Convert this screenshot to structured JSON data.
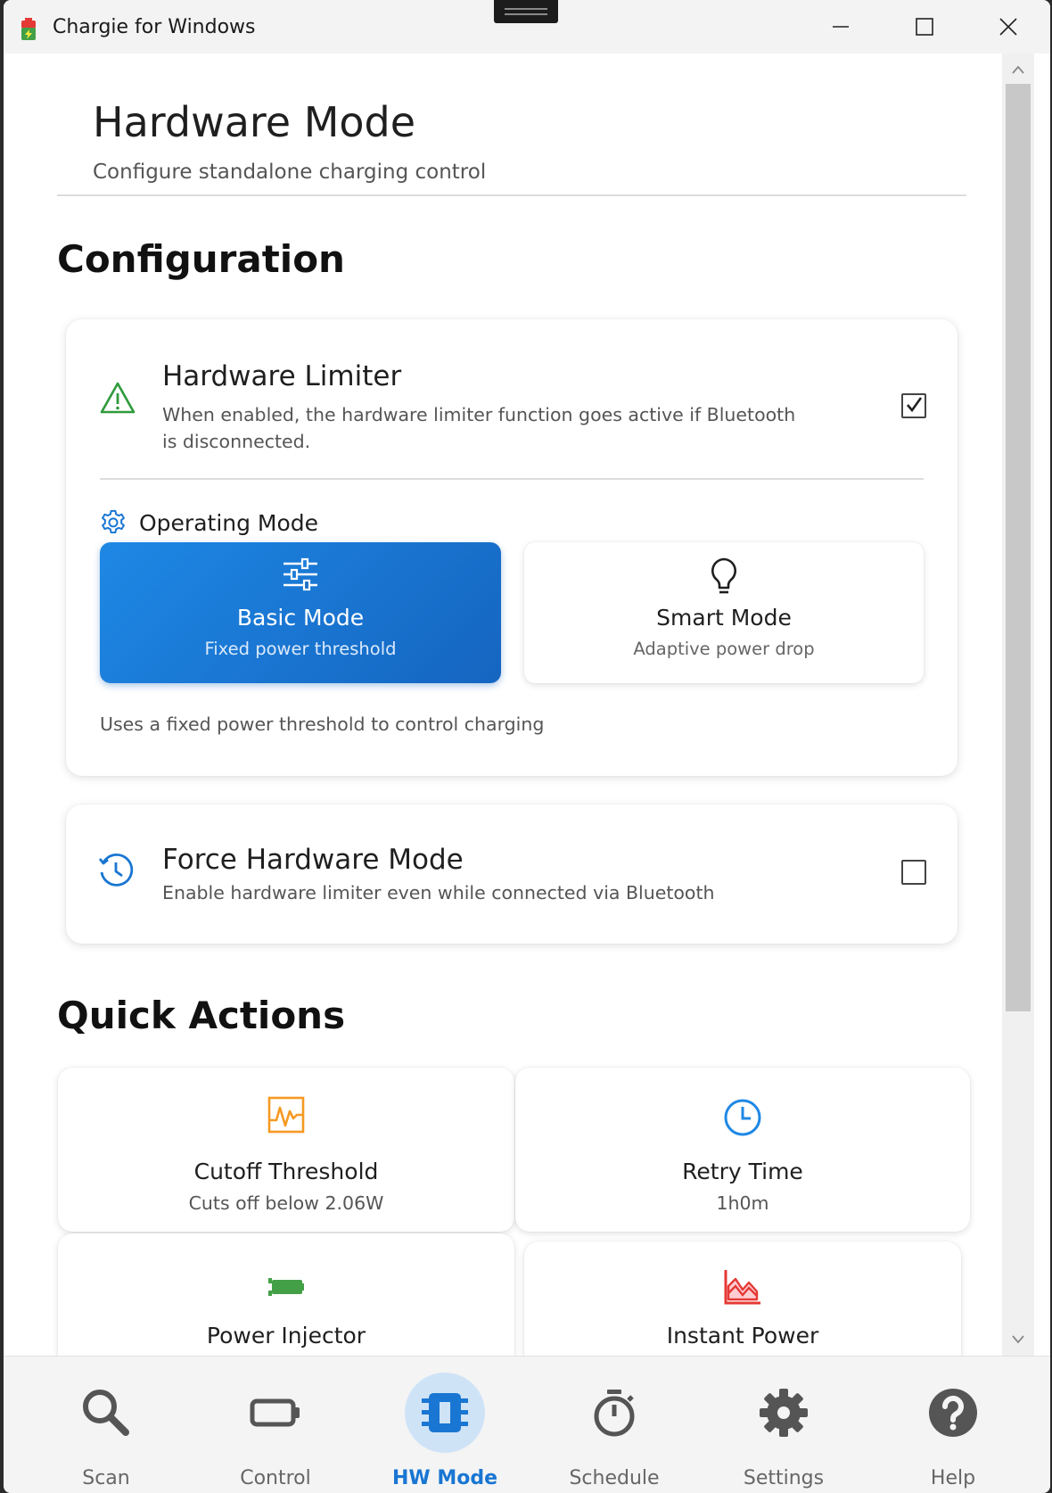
{
  "window": {
    "title": "Chargie for Windows"
  },
  "header": {
    "title": "Hardware Mode",
    "subtitle": "Configure standalone charging control"
  },
  "configuration": {
    "heading": "Configuration",
    "hardware_limiter": {
      "title": "Hardware Limiter",
      "description": "When enabled, the hardware limiter function goes active if Bluetooth is disconnected.",
      "checked": true
    },
    "operating_mode": {
      "label": "Operating Mode",
      "modes": [
        {
          "title": "Basic Mode",
          "subtitle": "Fixed power threshold",
          "selected": true
        },
        {
          "title": "Smart Mode",
          "subtitle": "Adaptive power drop",
          "selected": false
        }
      ],
      "description": "Uses a fixed power threshold to control charging"
    },
    "force_hardware_mode": {
      "title": "Force Hardware Mode",
      "description": "Enable hardware limiter even while connected via Bluetooth",
      "checked": false
    }
  },
  "quick_actions": {
    "heading": "Quick Actions",
    "items": [
      {
        "title": "Cutoff Threshold",
        "subtitle": "Cuts off below 2.06W",
        "icon": "pulse-chart-icon"
      },
      {
        "title": "Retry Time",
        "subtitle": "1h0m",
        "icon": "clock-icon"
      },
      {
        "title": "Power Injector",
        "subtitle": "",
        "icon": "battery-charging-icon"
      },
      {
        "title": "Instant Power",
        "subtitle": "",
        "icon": "area-chart-icon"
      }
    ]
  },
  "bottom_nav": {
    "items": [
      {
        "label": "Scan",
        "icon": "search-icon",
        "active": false
      },
      {
        "label": "Control",
        "icon": "battery-icon",
        "active": false
      },
      {
        "label": "HW Mode",
        "icon": "chip-icon",
        "active": true
      },
      {
        "label": "Schedule",
        "icon": "stopwatch-icon",
        "active": false
      },
      {
        "label": "Settings",
        "icon": "gear-icon",
        "active": false
      },
      {
        "label": "Help",
        "icon": "help-icon",
        "active": false
      }
    ]
  },
  "colors": {
    "accent": "#1976d2",
    "warning_green": "#2e9a3a",
    "orange": "#f59a23",
    "red": "#e53935"
  }
}
